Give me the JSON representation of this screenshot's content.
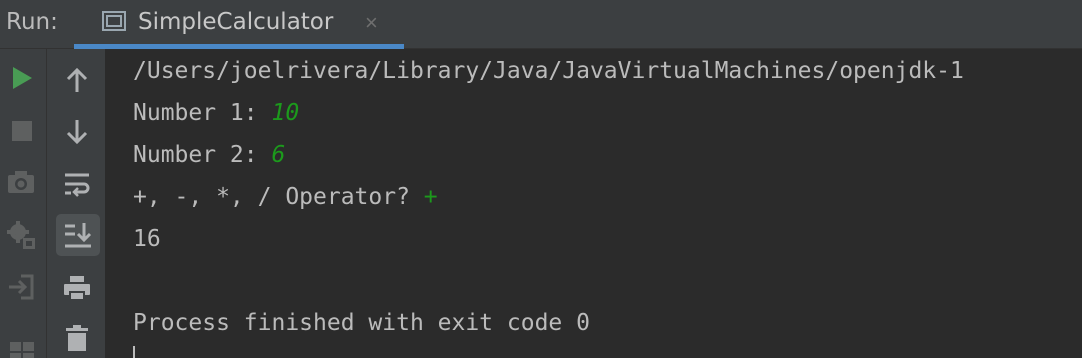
{
  "header": {
    "run_label": "Run:",
    "tab_title": "SimpleCalculator",
    "tab_close": "×",
    "accent_color": "#4a88c7"
  },
  "left_toolbar": [
    "run-icon",
    "stop-icon",
    "camera-icon",
    "settings-debug-icon",
    "import-icon",
    "layout-icon"
  ],
  "right_toolbar": [
    "up-arrow-icon",
    "down-arrow-icon",
    "soft-wrap-icon",
    "scroll-to-end-icon",
    "print-icon",
    "trash-icon"
  ],
  "console": {
    "path": "/Users/joelrivera/Library/Java/JavaVirtualMachines/openjdk-1",
    "prompt1": "Number 1: ",
    "input1": "10",
    "prompt2": "Number 2: ",
    "input2": "6",
    "prompt3": "+, -, *, / Operator? ",
    "input3": "+",
    "result": "16",
    "finish": "Process finished with exit code 0",
    "input_color": "#1c9a1c"
  }
}
